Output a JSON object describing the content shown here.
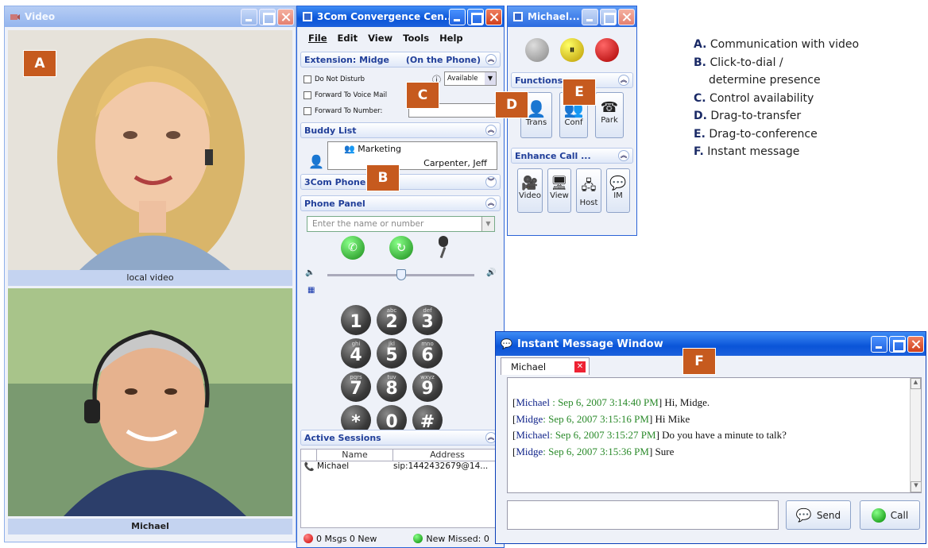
{
  "video_window": {
    "title": "Video",
    "local_caption": "local video",
    "remote_caption": "Michael"
  },
  "convergence_window": {
    "title": "3Com Convergence Cen...",
    "menu": [
      "File",
      "Edit",
      "View",
      "Tools",
      "Help"
    ],
    "extension": {
      "label": "Extension: Midge",
      "status": "(On the Phone)",
      "do_not_disturb": "Do Not Disturb",
      "fwd_voicemail": "Forward To Voice Mail",
      "fwd_number": "Forward To Number:",
      "availability": "Available"
    },
    "buddy_list": {
      "label": "Buddy List",
      "group": "Marketing",
      "contact": "Carpenter, Jeff"
    },
    "phone_section": {
      "label": "3Com Phone"
    },
    "phone_panel": {
      "label": "Phone Panel",
      "placeholder": "Enter the name or number"
    },
    "keypad": [
      {
        "d": "1",
        "s": ""
      },
      {
        "d": "2",
        "s": "abc"
      },
      {
        "d": "3",
        "s": "def"
      },
      {
        "d": "4",
        "s": "ghi"
      },
      {
        "d": "5",
        "s": "jkl"
      },
      {
        "d": "6",
        "s": "mno"
      },
      {
        "d": "7",
        "s": "pqrs"
      },
      {
        "d": "8",
        "s": "tuv"
      },
      {
        "d": "9",
        "s": "wxyz"
      },
      {
        "d": "*",
        "s": ""
      },
      {
        "d": "0",
        "s": ""
      },
      {
        "d": "#",
        "s": ""
      }
    ],
    "active_sessions": {
      "label": "Active Sessions",
      "col_name": "Name",
      "col_address": "Address",
      "rows": [
        {
          "name": "Michael",
          "address": "sip:1442432679@14..."
        }
      ]
    },
    "status": {
      "msgs": "0 Msgs 0 New",
      "missed": "New Missed: 0"
    }
  },
  "michael_window": {
    "title": "Michael...",
    "functions_label": "Functions",
    "functions": [
      "Trans",
      "Conf",
      "Park"
    ],
    "enhance_label": "Enhance Call ...",
    "enhance": [
      "Video",
      "View",
      "Host",
      "IM"
    ]
  },
  "im_window": {
    "title": "Instant Message Window",
    "tab": "Michael",
    "messages": [
      {
        "name": "Michael",
        "sep": " : ",
        "ts": "Sep 6, 2007 3:14:40 PM",
        "text": " Hi, Midge."
      },
      {
        "name": "Midge",
        "sep": ": ",
        "ts": "Sep 6, 2007 3:15:16 PM",
        "text": " Hi Mike"
      },
      {
        "name": "Michael",
        "sep": ": ",
        "ts": "Sep 6, 2007 3:15:27 PM",
        "text": " Do you have a minute to talk?"
      },
      {
        "name": "Midge",
        "sep": ": ",
        "ts": "Sep 6, 2007 3:15:36 PM",
        "text": " Sure"
      }
    ],
    "send": "Send",
    "call": "Call"
  },
  "markers": [
    "A",
    "B",
    "C",
    "D",
    "E",
    "F"
  ],
  "legend": [
    {
      "k": "A.",
      "v": "Communication with video"
    },
    {
      "k": "B.",
      "v": "Click-to-dial /"
    },
    {
      "k": "",
      "v": "determine presence"
    },
    {
      "k": "C.",
      "v": "Control availability"
    },
    {
      "k": "D.",
      "v": "Drag-to-transfer"
    },
    {
      "k": "E.",
      "v": "Drag-to-conference"
    },
    {
      "k": "F.",
      "v": "Instant message"
    }
  ]
}
